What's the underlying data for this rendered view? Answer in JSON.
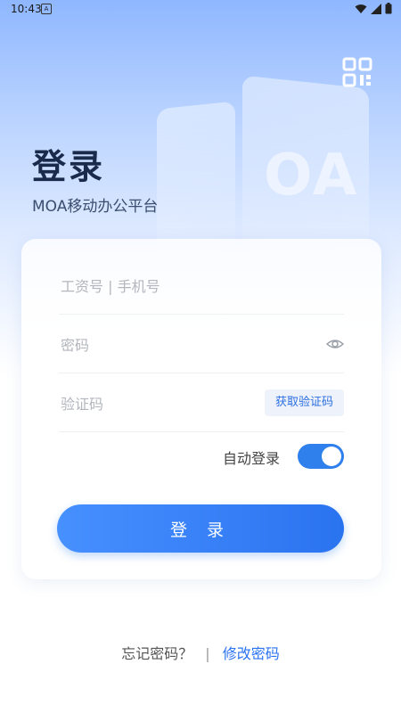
{
  "status_bar": {
    "time": "10:43",
    "notification_icon": "A",
    "icons": [
      "wifi-icon",
      "signal-icon",
      "battery-icon"
    ]
  },
  "header": {
    "title": "登录",
    "subtitle": "MOA移动办公平台",
    "decor_text": "OA",
    "qr_icon": "qr-code-icon"
  },
  "form": {
    "username_placeholder": "工资号 | 手机号",
    "password_placeholder": "密码",
    "code_placeholder": "验证码",
    "get_code_label": "获取验证码",
    "auto_login_label": "自动登录",
    "auto_login_enabled": true,
    "login_label": "登 录"
  },
  "footer": {
    "forgot_label": "忘记密码？",
    "divider": "|",
    "change_label": "修改密码"
  },
  "colors": {
    "accent": "#2f80ed",
    "title": "#1a2a4a"
  }
}
